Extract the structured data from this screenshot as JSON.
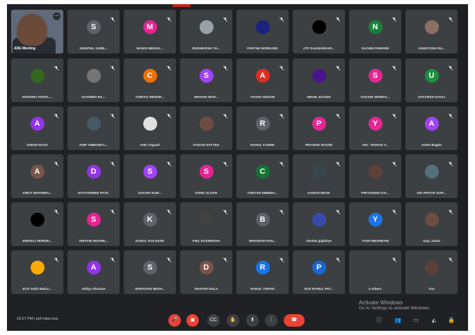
{
  "self": {
    "name": "ADE Meeting",
    "more_label": "⋯"
  },
  "participants": [
    {
      "name": "SWAPNIL SURB...",
      "initial": "S",
      "color": "#5f6368",
      "photo": false
    },
    {
      "name": "MANSI MEENA...",
      "initial": "M",
      "color": "#e52592",
      "photo": false
    },
    {
      "name": "RUSHIKESH TH...",
      "initial": "",
      "color": "#9aa0a6",
      "photo": true
    },
    {
      "name": "PARTHE BORKARE",
      "initial": "",
      "color": "#1a237e",
      "photo": true
    },
    {
      "name": "ATF GALWANKAR...",
      "initial": "",
      "color": "#000000",
      "photo": true
    },
    {
      "name": "SACHIN PAWARE",
      "initial": "N",
      "color": "#188038",
      "photo": false
    },
    {
      "name": "ASHUTOSH DU...",
      "initial": "",
      "color": "#8d6e63",
      "photo": true
    },
    {
      "name": "KRISHNA POPAL...",
      "initial": "",
      "color": "#33691e",
      "photo": true
    },
    {
      "name": "DASHMEI RA...",
      "initial": "",
      "color": "#757575",
      "photo": true
    },
    {
      "name": "CHIRAG MESHR...",
      "initial": "C",
      "color": "#e8710a",
      "photo": false
    },
    {
      "name": "SHIVANI MAR...",
      "initial": "S",
      "color": "#a142f4",
      "photo": false
    },
    {
      "name": "AYUSH GEDAM",
      "initial": "A",
      "color": "#d93025",
      "photo": false
    },
    {
      "name": "NIKHIL BAGDE",
      "initial": "",
      "color": "#4a148c",
      "photo": true
    },
    {
      "name": "SAKSHI SHIRKO...",
      "initial": "S",
      "color": "#e52592",
      "photo": false
    },
    {
      "name": "UTKARSH KOOLI",
      "initial": "U",
      "color": "#1e8e3e",
      "photo": false
    },
    {
      "name": "ADESH RAUT",
      "initial": "A",
      "color": "#9334e6",
      "photo": false
    },
    {
      "name": "ANIP AMBODKA...",
      "initial": "",
      "color": "#455a64",
      "photo": true
    },
    {
      "name": "ADE Cegaml",
      "initial": "",
      "color": "#e0e0e0",
      "photo": true
    },
    {
      "name": "FAIZAN SAYYED",
      "initial": "",
      "color": "#6d4c41",
      "photo": true
    },
    {
      "name": "RAHUL KANNE",
      "initial": "R",
      "color": "#5f6368",
      "photo": false
    },
    {
      "name": "PRASHIK RAUSE",
      "initial": "P",
      "color": "#e52592",
      "photo": false
    },
    {
      "name": "ADI - ROHAN T...",
      "initial": "Y",
      "color": "#e52592",
      "photo": false
    },
    {
      "name": "Anket Bagde",
      "initial": "A",
      "color": "#a142f4",
      "photo": false
    },
    {
      "name": "ANKIT BHAIRWA...",
      "initial": "A",
      "color": "#795548",
      "photo": false
    },
    {
      "name": "DIVYASHREE PATIL",
      "initial": "D",
      "color": "#9334e6",
      "photo": false
    },
    {
      "name": "SAKSHI KUM...",
      "initial": "S",
      "color": "#a142f4",
      "photo": false
    },
    {
      "name": "SONG SLOAN",
      "initial": "S",
      "color": "#e52592",
      "photo": false
    },
    {
      "name": "CHETAN NIMBEK...",
      "initial": "C",
      "color": "#137333",
      "photo": false
    },
    {
      "name": "KARAN NEGE",
      "initial": "",
      "color": "#37474f",
      "photo": true
    },
    {
      "name": "PRIYANSHU KO...",
      "initial": "",
      "color": "#5d4037",
      "photo": true
    },
    {
      "name": "ADI PRATIK KUR...",
      "initial": "",
      "color": "#546e7a",
      "photo": true
    },
    {
      "name": "SWARAJ BORDE...",
      "initial": "",
      "color": "#000000",
      "photo": true
    },
    {
      "name": "SHIVANI MAURE...",
      "initial": "S",
      "color": "#e52592",
      "photo": false
    },
    {
      "name": "KUNAL KOLHADE",
      "initial": "K",
      "color": "#5f6368",
      "photo": false
    },
    {
      "name": "ANIL KUSHWAHA",
      "initial": "",
      "color": "#424242",
      "photo": true
    },
    {
      "name": "BHAVESH NAN...",
      "initial": "B",
      "color": "#5f6368",
      "photo": false
    },
    {
      "name": "Akshat gajbhiye",
      "initial": "",
      "color": "#3949ab",
      "photo": true
    },
    {
      "name": "YASH MESHRAM",
      "initial": "Y",
      "color": "#1a73e8",
      "photo": false
    },
    {
      "name": "Ajay Jaisal",
      "initial": "",
      "color": "#6d4c41",
      "photo": true
    },
    {
      "name": "ECE Ankit Bakar...",
      "initial": "",
      "color": "#f9ab00",
      "photo": true
    },
    {
      "name": "Aditya Dhulase",
      "initial": "A",
      "color": "#9334e6",
      "photo": false
    },
    {
      "name": "SHRAVANI NESH...",
      "initial": "S",
      "color": "#5f6368",
      "photo": false
    },
    {
      "name": "SHAYAN DULA",
      "initial": "D",
      "color": "#795548",
      "photo": false
    },
    {
      "name": "RAHUL TIWARI",
      "initial": "R",
      "color": "#1a73e8",
      "photo": false
    },
    {
      "name": "ECE RAHUL PAT...",
      "initial": "P",
      "color": "#1967d2",
      "photo": false
    },
    {
      "name": "4 others",
      "initial": "",
      "color": "#3c4043",
      "photo": false
    },
    {
      "name": "You",
      "initial": "",
      "color": "#5d4037",
      "photo": true
    }
  ],
  "bottom_bar": {
    "meeting_info": "10:27 PM  |  pxf-mbrx-ksz",
    "controls": [
      "mic-off",
      "cam-off",
      "captions",
      "raise-hand",
      "present",
      "more",
      "leave"
    ],
    "right_icons": [
      "info",
      "people",
      "chat",
      "activities",
      "lock"
    ]
  },
  "watermark": {
    "line1": "Activate Windows",
    "line2": "Go to Settings to activate Windows."
  },
  "colors": {
    "background": "#202124",
    "tile": "#3c4043",
    "red": "#ea4335"
  }
}
